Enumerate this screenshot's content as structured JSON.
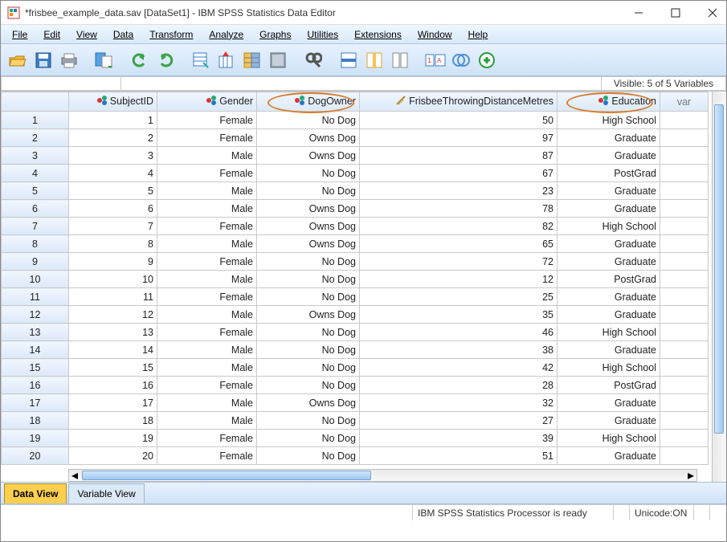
{
  "window": {
    "title": "*frisbee_example_data.sav [DataSet1] - IBM SPSS Statistics Data Editor"
  },
  "menu": [
    "File",
    "Edit",
    "View",
    "Data",
    "Transform",
    "Analyze",
    "Graphs",
    "Utilities",
    "Extensions",
    "Window",
    "Help"
  ],
  "info": {
    "visible": "Visible: 5 of 5 Variables"
  },
  "columns": {
    "subject": "SubjectID",
    "gender": "Gender",
    "dog": "DogOwner",
    "dist": "FrisbeeThrowingDistanceMetres",
    "edu": "Education",
    "var": "var"
  },
  "rows": [
    {
      "n": "1",
      "subj": "1",
      "gend": "Female",
      "dog": "No Dog",
      "dist": "50",
      "edu": "High School"
    },
    {
      "n": "2",
      "subj": "2",
      "gend": "Female",
      "dog": "Owns Dog",
      "dist": "97",
      "edu": "Graduate"
    },
    {
      "n": "3",
      "subj": "3",
      "gend": "Male",
      "dog": "Owns Dog",
      "dist": "87",
      "edu": "Graduate"
    },
    {
      "n": "4",
      "subj": "4",
      "gend": "Female",
      "dog": "No Dog",
      "dist": "67",
      "edu": "PostGrad"
    },
    {
      "n": "5",
      "subj": "5",
      "gend": "Male",
      "dog": "No Dog",
      "dist": "23",
      "edu": "Graduate"
    },
    {
      "n": "6",
      "subj": "6",
      "gend": "Male",
      "dog": "Owns Dog",
      "dist": "78",
      "edu": "Graduate"
    },
    {
      "n": "7",
      "subj": "7",
      "gend": "Female",
      "dog": "Owns Dog",
      "dist": "82",
      "edu": "High School"
    },
    {
      "n": "8",
      "subj": "8",
      "gend": "Male",
      "dog": "Owns Dog",
      "dist": "65",
      "edu": "Graduate"
    },
    {
      "n": "9",
      "subj": "9",
      "gend": "Female",
      "dog": "No Dog",
      "dist": "72",
      "edu": "Graduate"
    },
    {
      "n": "10",
      "subj": "10",
      "gend": "Male",
      "dog": "No Dog",
      "dist": "12",
      "edu": "PostGrad"
    },
    {
      "n": "11",
      "subj": "11",
      "gend": "Female",
      "dog": "No Dog",
      "dist": "25",
      "edu": "Graduate"
    },
    {
      "n": "12",
      "subj": "12",
      "gend": "Male",
      "dog": "Owns Dog",
      "dist": "35",
      "edu": "Graduate"
    },
    {
      "n": "13",
      "subj": "13",
      "gend": "Female",
      "dog": "No Dog",
      "dist": "46",
      "edu": "High School"
    },
    {
      "n": "14",
      "subj": "14",
      "gend": "Male",
      "dog": "No Dog",
      "dist": "38",
      "edu": "Graduate"
    },
    {
      "n": "15",
      "subj": "15",
      "gend": "Male",
      "dog": "No Dog",
      "dist": "42",
      "edu": "High School"
    },
    {
      "n": "16",
      "subj": "16",
      "gend": "Female",
      "dog": "No Dog",
      "dist": "28",
      "edu": "PostGrad"
    },
    {
      "n": "17",
      "subj": "17",
      "gend": "Male",
      "dog": "Owns Dog",
      "dist": "32",
      "edu": "Graduate"
    },
    {
      "n": "18",
      "subj": "18",
      "gend": "Male",
      "dog": "No Dog",
      "dist": "27",
      "edu": "Graduate"
    },
    {
      "n": "19",
      "subj": "19",
      "gend": "Female",
      "dog": "No Dog",
      "dist": "39",
      "edu": "High School"
    },
    {
      "n": "20",
      "subj": "20",
      "gend": "Female",
      "dog": "No Dog",
      "dist": "51",
      "edu": "Graduate"
    }
  ],
  "tabs": {
    "data": "Data View",
    "variable": "Variable View"
  },
  "status": {
    "processor": "IBM SPSS Statistics Processor is ready",
    "unicode": "Unicode:ON"
  }
}
